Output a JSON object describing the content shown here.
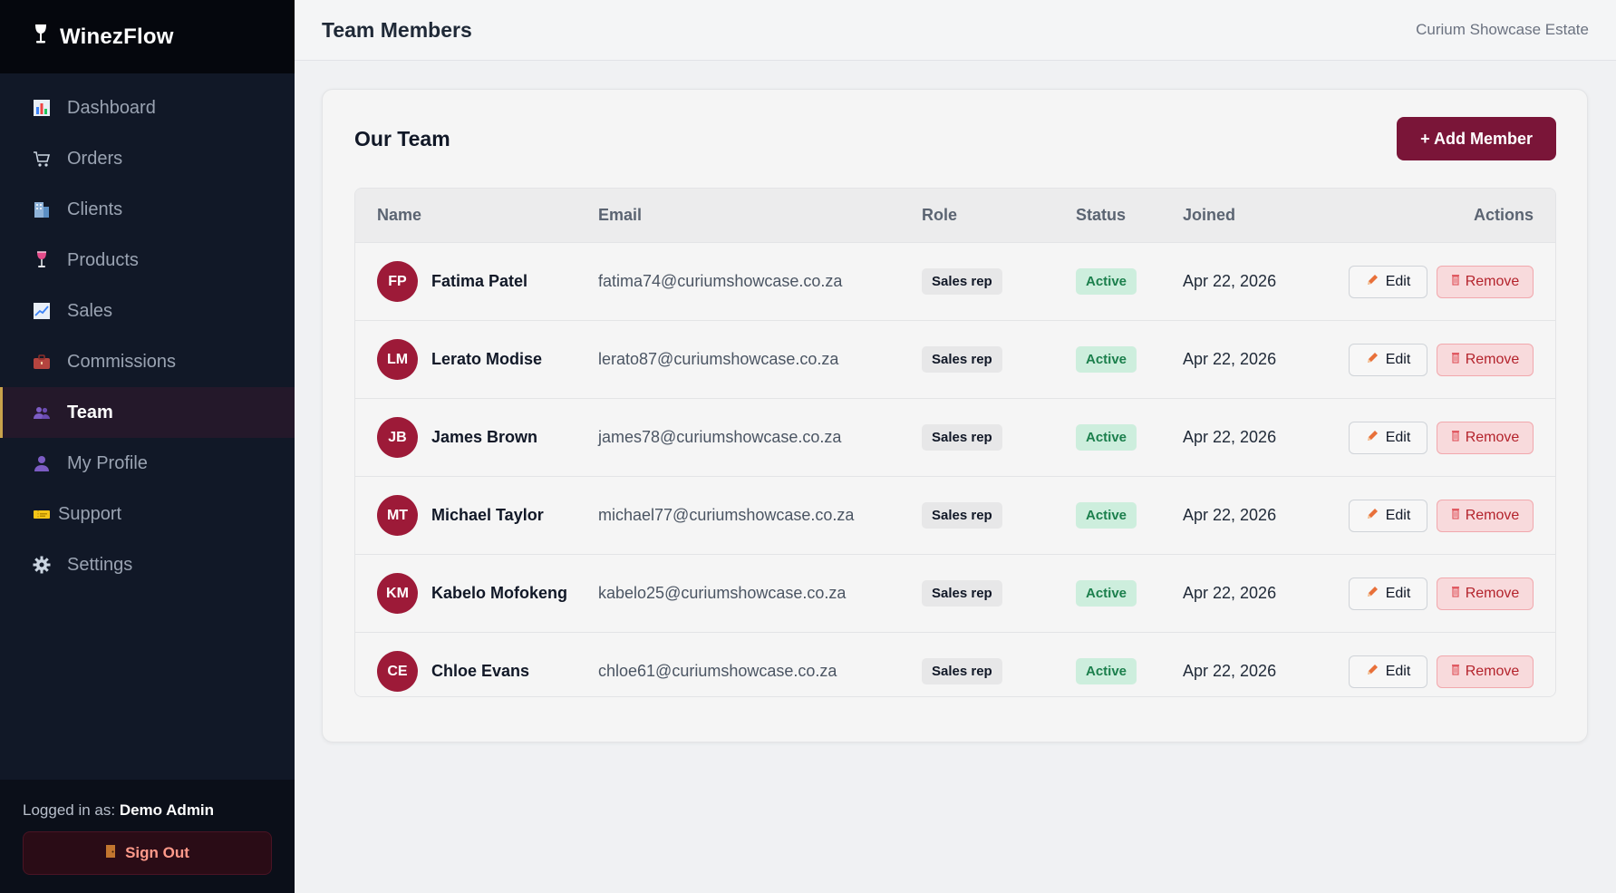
{
  "app": {
    "brand": "WinezFlow",
    "estate": "Curium Showcase Estate",
    "page_title": "Team Members"
  },
  "sidebar": {
    "items": [
      {
        "label": "Dashboard",
        "icon": "bar-chart-icon"
      },
      {
        "label": "Orders",
        "icon": "cart-icon"
      },
      {
        "label": "Clients",
        "icon": "building-icon"
      },
      {
        "label": "Products",
        "icon": "wine-glass-icon"
      },
      {
        "label": "Sales",
        "icon": "line-chart-icon"
      },
      {
        "label": "Commissions",
        "icon": "briefcase-icon"
      },
      {
        "label": "Team",
        "icon": "people-icon",
        "active": true
      },
      {
        "label": "My Profile",
        "icon": "person-icon"
      },
      {
        "label": "Support",
        "icon": "ticket-icon"
      },
      {
        "label": "Settings",
        "icon": "gear-icon"
      }
    ],
    "footer": {
      "logged_in_label": "Logged in as:",
      "user": "Demo Admin",
      "sign_out": "Sign Out"
    }
  },
  "card": {
    "title": "Our Team",
    "add_button": "+ Add Member"
  },
  "table": {
    "headers": {
      "name": "Name",
      "email": "Email",
      "role": "Role",
      "status": "Status",
      "joined": "Joined",
      "actions": "Actions"
    },
    "edit_label": "Edit",
    "remove_label": "Remove",
    "rows": [
      {
        "initials": "FP",
        "name": "Fatima Patel",
        "email": "fatima74@curiumshowcase.co.za",
        "role": "Sales rep",
        "status": "Active",
        "joined": "Apr 22, 2026"
      },
      {
        "initials": "LM",
        "name": "Lerato Modise",
        "email": "lerato87@curiumshowcase.co.za",
        "role": "Sales rep",
        "status": "Active",
        "joined": "Apr 22, 2026"
      },
      {
        "initials": "JB",
        "name": "James Brown",
        "email": "james78@curiumshowcase.co.za",
        "role": "Sales rep",
        "status": "Active",
        "joined": "Apr 22, 2026"
      },
      {
        "initials": "MT",
        "name": "Michael Taylor",
        "email": "michael77@curiumshowcase.co.za",
        "role": "Sales rep",
        "status": "Active",
        "joined": "Apr 22, 2026"
      },
      {
        "initials": "KM",
        "name": "Kabelo Mofokeng",
        "email": "kabelo25@curiumshowcase.co.za",
        "role": "Sales rep",
        "status": "Active",
        "joined": "Apr 22, 2026"
      },
      {
        "initials": "CE",
        "name": "Chloe Evans",
        "email": "chloe61@curiumshowcase.co.za",
        "role": "Sales rep",
        "status": "Active",
        "joined": "Apr 22, 2026"
      }
    ]
  },
  "colors": {
    "accent": "#7a1538",
    "sidebar_bg": "#111827",
    "avatar": "#9d1a38",
    "active_status": "#1b7f4c",
    "remove": "#b4232c"
  }
}
